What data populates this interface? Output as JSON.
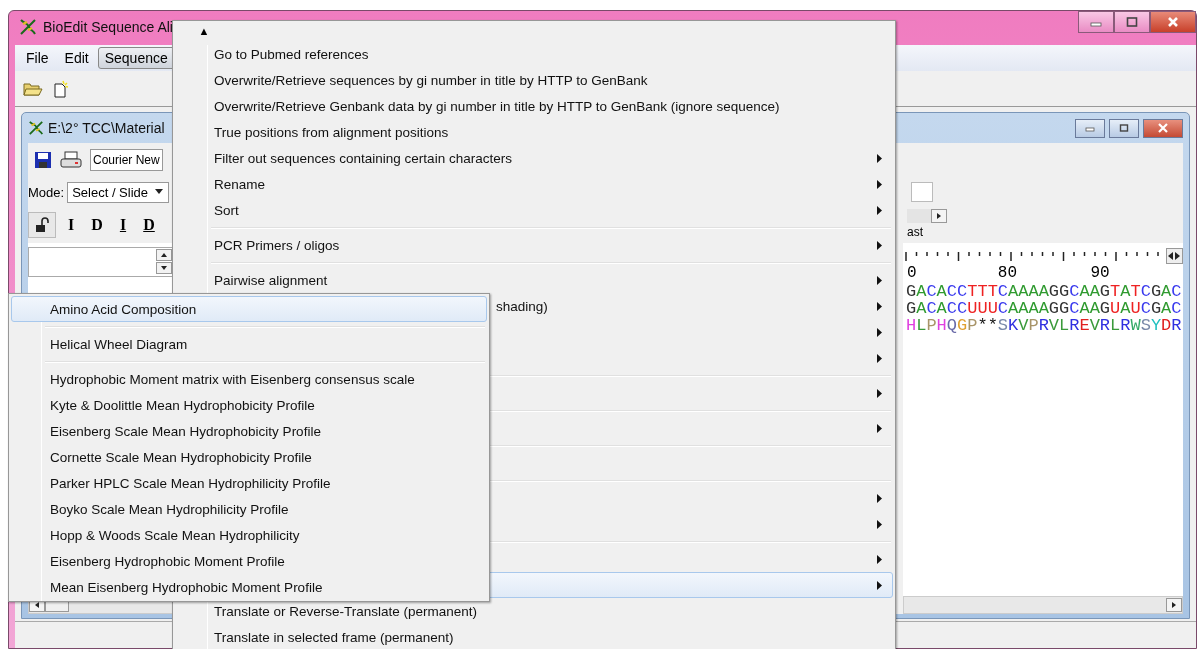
{
  "main_window": {
    "title": "BioEdit Sequence Ali"
  },
  "menu_bar": [
    {
      "label": "File",
      "selected": false
    },
    {
      "label": "Edit",
      "selected": false
    },
    {
      "label": "Sequence",
      "selected": true
    }
  ],
  "document_window": {
    "title": "E:\\2° TCC\\Material",
    "font_combo": "Courier New",
    "mode_label": "Mode:",
    "mode_combo": "Select / Slide",
    "edit_buttons": [
      {
        "label": "I",
        "kind": "plain"
      },
      {
        "label": "D",
        "kind": "plain"
      },
      {
        "label": "I",
        "kind": "underlined"
      },
      {
        "label": "D",
        "kind": "underlined"
      }
    ],
    "speed_label": "ast",
    "ruler_labels": [
      "0",
      "80",
      "90"
    ],
    "sequences": [
      {
        "kind": "nucleotide",
        "text": "GACACCTTTCAAAAGGCAAGTATCGAC"
      },
      {
        "kind": "nucleotide",
        "text": "GACACCUUUCAAAAGGCAAGUAUCGAC"
      },
      {
        "kind": "protein",
        "text": "HLPHQGP**SKVPRVLREVRLRWSYDR"
      }
    ]
  },
  "sequence_menu": {
    "scroll_up": "▲",
    "items": [
      {
        "kind": "item",
        "label": "Go to Pubmed references",
        "submenu": false,
        "selected": false
      },
      {
        "kind": "item",
        "label": "Overwrite/Retrieve sequences by gi number in title by HTTP to GenBank",
        "submenu": false,
        "selected": false
      },
      {
        "kind": "item",
        "label": "Overwrite/Retrieve Genbank data by gi number in title by HTTP to GenBank (ignore sequence)",
        "submenu": false,
        "selected": false
      },
      {
        "kind": "item",
        "label": "True positions from alignment positions",
        "submenu": false,
        "selected": false
      },
      {
        "kind": "item",
        "label": "Filter out sequences containing certain characters",
        "submenu": true,
        "selected": false
      },
      {
        "kind": "item",
        "label": "Rename",
        "submenu": true,
        "selected": false
      },
      {
        "kind": "item",
        "label": "Sort",
        "submenu": true,
        "selected": false
      },
      {
        "kind": "separator"
      },
      {
        "kind": "item",
        "label": "PCR Primers / oligos",
        "submenu": true,
        "selected": false
      },
      {
        "kind": "separator"
      },
      {
        "kind": "item",
        "label": "Pairwise alignment",
        "submenu": true,
        "selected": false
      },
      {
        "kind": "clipped",
        "label": "shading)",
        "submenu": true,
        "selected": false
      },
      {
        "kind": "item",
        "submenu": true,
        "selected": false
      },
      {
        "kind": "item",
        "submenu": true,
        "selected": false
      },
      {
        "kind": "separator"
      },
      {
        "kind": "item",
        "submenu": true,
        "selected": false
      },
      {
        "kind": "separator"
      },
      {
        "kind": "item",
        "submenu": true,
        "selected": false
      },
      {
        "kind": "separator"
      },
      {
        "kind": "item",
        "submenu": false,
        "selected": false
      },
      {
        "kind": "separator"
      },
      {
        "kind": "item",
        "submenu": true,
        "selected": false
      },
      {
        "kind": "item",
        "submenu": true,
        "selected": false
      },
      {
        "kind": "separator"
      },
      {
        "kind": "item",
        "submenu": true,
        "selected": false
      },
      {
        "kind": "item",
        "submenu": true,
        "selected": true
      },
      {
        "kind": "item",
        "label": "Translate or Reverse-Translate (permanent)",
        "submenu": false,
        "selected": false
      },
      {
        "kind": "item",
        "label": "Translate in selected frame (permanent)",
        "submenu": false,
        "selected": false
      }
    ]
  },
  "protein_submenu": {
    "items": [
      {
        "kind": "item",
        "label": "Amino Acid Composition",
        "selected": true
      },
      {
        "kind": "separator"
      },
      {
        "kind": "item",
        "label": "Helical Wheel Diagram",
        "selected": false
      },
      {
        "kind": "separator"
      },
      {
        "kind": "item",
        "label": "Hydrophobic Moment matrix with Eisenberg consensus scale",
        "selected": false
      },
      {
        "kind": "item",
        "label": "Kyte & Doolittle Mean Hydrophobicity Profile",
        "selected": false
      },
      {
        "kind": "item",
        "label": "Eisenberg Scale Mean Hydrophobicity Profile",
        "selected": false
      },
      {
        "kind": "item",
        "label": "Cornette Scale Mean Hydrophobicity Profile",
        "selected": false
      },
      {
        "kind": "item",
        "label": "Parker HPLC Scale Mean Hydrophilicity Profile",
        "selected": false
      },
      {
        "kind": "item",
        "label": "Boyko Scale Mean Hydrophilicity Profile",
        "selected": false
      },
      {
        "kind": "item",
        "label": "Hopp & Woods Scale Mean Hydrophilicity",
        "selected": false
      },
      {
        "kind": "item",
        "label": "Eisenberg Hydrophobic Moment Profile",
        "selected": false
      },
      {
        "kind": "item",
        "label": "Mean Eisenberg Hydrophobic Moment Profile",
        "selected": false
      }
    ]
  }
}
